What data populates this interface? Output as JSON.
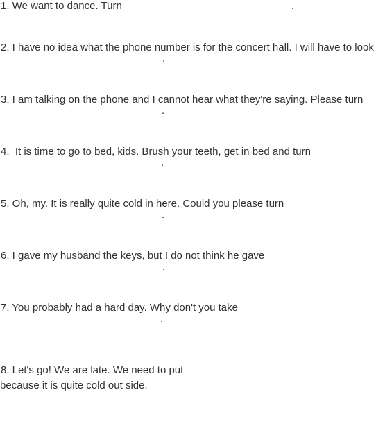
{
  "items": [
    {
      "number": "1.",
      "text": " We want to dance. Turn",
      "end": "."
    },
    {
      "number": "2.",
      "text": " I have no idea what the phone number is for the concert hall. I will have to look",
      "end": "."
    },
    {
      "number": "3.",
      "text": " I am talking on the phone and I cannot hear what they're saying. Please turn",
      "end": "."
    },
    {
      "number": "4.",
      "text": "  It is time to go to bed, kids. Brush your teeth, get in bed and turn",
      "end": "."
    },
    {
      "number": "5.",
      "text": " Oh, my. It is really quite cold in here. Could you please turn",
      "end": "."
    },
    {
      "number": "6.",
      "text": " I gave my husband the keys, but I do not think he gave",
      "end": "."
    },
    {
      "number": "7.",
      "text": " You probably had a hard day. Why don't you take",
      "end": "."
    },
    {
      "number": "8.",
      "text": " Let's go! We are late. We need to put",
      "continuation": "because it is quite cold out side."
    }
  ]
}
